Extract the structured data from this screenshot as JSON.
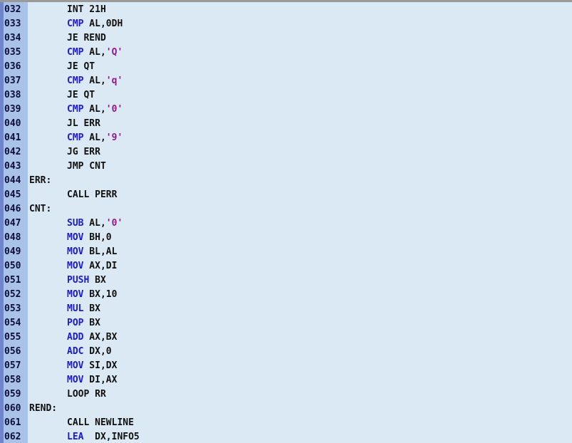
{
  "colors": {
    "background": "#dbe9f4",
    "gutter": "#a9c2e8",
    "gutter_strip": "#6f86c9",
    "keyword": "#1a1ad6",
    "string": "#8c1a8c",
    "text": "#101010"
  },
  "code_lines": [
    {
      "num": "032",
      "tokens": [
        {
          "t": "INT 21H",
          "c": "plain"
        }
      ]
    },
    {
      "num": "033",
      "tokens": [
        {
          "t": "CMP",
          "c": "kw"
        },
        {
          "t": " AL,0DH",
          "c": "plain"
        }
      ]
    },
    {
      "num": "034",
      "tokens": [
        {
          "t": "JE REND",
          "c": "plain"
        }
      ]
    },
    {
      "num": "035",
      "tokens": [
        {
          "t": "CMP",
          "c": "kw"
        },
        {
          "t": " AL,",
          "c": "plain"
        },
        {
          "t": "'Q'",
          "c": "str"
        }
      ]
    },
    {
      "num": "036",
      "tokens": [
        {
          "t": "JE QT",
          "c": "plain"
        }
      ]
    },
    {
      "num": "037",
      "tokens": [
        {
          "t": "CMP",
          "c": "kw"
        },
        {
          "t": " AL,",
          "c": "plain"
        },
        {
          "t": "'q'",
          "c": "str"
        }
      ]
    },
    {
      "num": "038",
      "tokens": [
        {
          "t": "JE QT",
          "c": "plain"
        }
      ]
    },
    {
      "num": "039",
      "tokens": [
        {
          "t": "CMP",
          "c": "kw"
        },
        {
          "t": " AL,",
          "c": "plain"
        },
        {
          "t": "'0'",
          "c": "str"
        }
      ]
    },
    {
      "num": "040",
      "tokens": [
        {
          "t": "JL ERR",
          "c": "plain"
        }
      ]
    },
    {
      "num": "041",
      "tokens": [
        {
          "t": "CMP",
          "c": "kw"
        },
        {
          "t": " AL,",
          "c": "plain"
        },
        {
          "t": "'9'",
          "c": "str"
        }
      ]
    },
    {
      "num": "042",
      "tokens": [
        {
          "t": "JG ERR",
          "c": "plain"
        }
      ]
    },
    {
      "num": "043",
      "tokens": [
        {
          "t": "JMP CNT",
          "c": "plain"
        }
      ]
    },
    {
      "num": "044",
      "label": "ERR:",
      "tokens": []
    },
    {
      "num": "045",
      "tokens": [
        {
          "t": "CALL PERR",
          "c": "plain"
        }
      ]
    },
    {
      "num": "046",
      "label": "CNT:",
      "tokens": []
    },
    {
      "num": "047",
      "tokens": [
        {
          "t": "SUB",
          "c": "kw"
        },
        {
          "t": " AL,",
          "c": "plain"
        },
        {
          "t": "'0'",
          "c": "str"
        }
      ]
    },
    {
      "num": "048",
      "tokens": [
        {
          "t": "MOV",
          "c": "kw"
        },
        {
          "t": " BH,0",
          "c": "plain"
        }
      ]
    },
    {
      "num": "049",
      "tokens": [
        {
          "t": "MOV",
          "c": "kw"
        },
        {
          "t": " BL,AL",
          "c": "plain"
        }
      ]
    },
    {
      "num": "050",
      "tokens": [
        {
          "t": "MOV",
          "c": "kw"
        },
        {
          "t": " AX,DI",
          "c": "plain"
        }
      ]
    },
    {
      "num": "051",
      "tokens": [
        {
          "t": "PUSH",
          "c": "kw"
        },
        {
          "t": " BX",
          "c": "plain"
        }
      ]
    },
    {
      "num": "052",
      "tokens": [
        {
          "t": "MOV",
          "c": "kw"
        },
        {
          "t": " BX,10",
          "c": "plain"
        }
      ]
    },
    {
      "num": "053",
      "tokens": [
        {
          "t": "MUL",
          "c": "kw"
        },
        {
          "t": " BX",
          "c": "plain"
        }
      ]
    },
    {
      "num": "054",
      "tokens": [
        {
          "t": "POP",
          "c": "kw"
        },
        {
          "t": " BX",
          "c": "plain"
        }
      ]
    },
    {
      "num": "055",
      "tokens": [
        {
          "t": "ADD",
          "c": "kw"
        },
        {
          "t": " AX,BX",
          "c": "plain"
        }
      ]
    },
    {
      "num": "056",
      "tokens": [
        {
          "t": "ADC",
          "c": "kw"
        },
        {
          "t": " DX,0",
          "c": "plain"
        }
      ]
    },
    {
      "num": "057",
      "tokens": [
        {
          "t": "MOV",
          "c": "kw"
        },
        {
          "t": " SI,DX",
          "c": "plain"
        }
      ]
    },
    {
      "num": "058",
      "tokens": [
        {
          "t": "MOV",
          "c": "kw"
        },
        {
          "t": " DI,AX",
          "c": "plain"
        }
      ]
    },
    {
      "num": "059",
      "tokens": [
        {
          "t": "LOOP RR",
          "c": "plain"
        }
      ]
    },
    {
      "num": "060",
      "label": "REND:",
      "tokens": []
    },
    {
      "num": "061",
      "tokens": [
        {
          "t": "CALL NEWLINE",
          "c": "plain"
        }
      ]
    },
    {
      "num": "062",
      "tokens": [
        {
          "t": "LEA",
          "c": "kw"
        },
        {
          "t": "  DX,INFO5",
          "c": "plain"
        }
      ]
    }
  ]
}
